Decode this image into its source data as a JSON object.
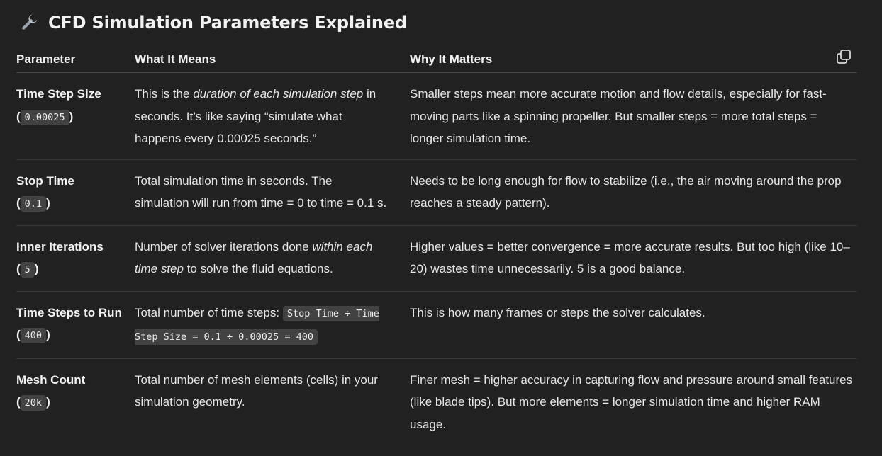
{
  "heading": {
    "icon": "wrench-icon",
    "title": "CFD Simulation Parameters Explained"
  },
  "copy_button": {
    "icon": "copy-icon"
  },
  "table": {
    "headers": [
      "Parameter",
      "What It Means",
      "Why It Matters"
    ],
    "rows": [
      {
        "param_name": "Time Step Size",
        "param_open": "(",
        "param_code": "0.00025",
        "param_close": ")",
        "means_pre": "This is the ",
        "means_em": "duration of each simulation step",
        "means_post": " in seconds. It’s like saying “simulate what happens every 0.00025 seconds.”",
        "why": "Smaller steps mean more accurate motion and flow details, especially for fast-moving parts like a spinning propeller. But smaller steps = more total steps = longer simulation time."
      },
      {
        "param_name": "Stop Time",
        "param_open": "(",
        "param_code": "0.1",
        "param_close": ")",
        "means": "Total simulation time in seconds. The simulation will run from time = 0 to time = 0.1 s.",
        "why": "Needs to be long enough for flow to stabilize (i.e., the air moving around the prop reaches a steady pattern)."
      },
      {
        "param_name": "Inner Iterations",
        "param_open": "(",
        "param_code": "5",
        "param_close": ")",
        "means_pre": "Number of solver iterations done ",
        "means_em": "within each time step",
        "means_post": " to solve the fluid equations.",
        "why": "Higher values = better convergence = more accurate results. But too high (like 10–20) wastes time unnecessarily. 5 is a good balance."
      },
      {
        "param_name": "Time Steps to Run",
        "param_open": "(",
        "param_code": "400",
        "param_close": ")",
        "means_pre": "Total number of time steps: ",
        "means_code": "Stop Time ÷ Time Step Size = 0.1 ÷ 0.00025 = 400",
        "why": "This is how many frames or steps the solver calculates."
      },
      {
        "param_name": "Mesh Count",
        "param_open": "(",
        "param_code": "20k",
        "param_close": ")",
        "means": "Total number of mesh elements (cells) in your simulation geometry.",
        "why": "Finer mesh = higher accuracy in capturing flow and pressure around small features (like blade tips). But more elements = longer simulation time and higher RAM usage."
      }
    ]
  }
}
